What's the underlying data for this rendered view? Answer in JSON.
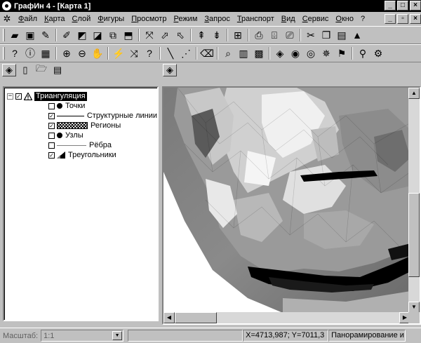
{
  "window": {
    "title": "ГрафИн 4 - [Карта 1]"
  },
  "menu": [
    "Файл",
    "Карта",
    "Слой",
    "Фигуры",
    "Просмотр",
    "Режим",
    "Запрос",
    "Транспорт",
    "Вид",
    "Сервис",
    "Окно",
    "?"
  ],
  "layer_tree": {
    "root": "Триангуляция",
    "items": [
      {
        "label": "Точки",
        "checked": false,
        "symbol": "dot-icon"
      },
      {
        "label": "Структурные линии",
        "checked": true,
        "symbol": "line-icon"
      },
      {
        "label": "Регионы",
        "checked": true,
        "symbol": "hatch-icon"
      },
      {
        "label": "Узлы",
        "checked": false,
        "symbol": "dot-icon"
      },
      {
        "label": "Рёбра",
        "checked": false,
        "symbol": "thin-line-icon"
      },
      {
        "label": "Треугольники",
        "checked": true,
        "symbol": "triangle-icon"
      }
    ]
  },
  "status": {
    "scale_label": "Масштаб:",
    "scale_value": "1:1",
    "coords": "X=4713,987; Y=7011,3",
    "mode": "Панорамирование и"
  }
}
